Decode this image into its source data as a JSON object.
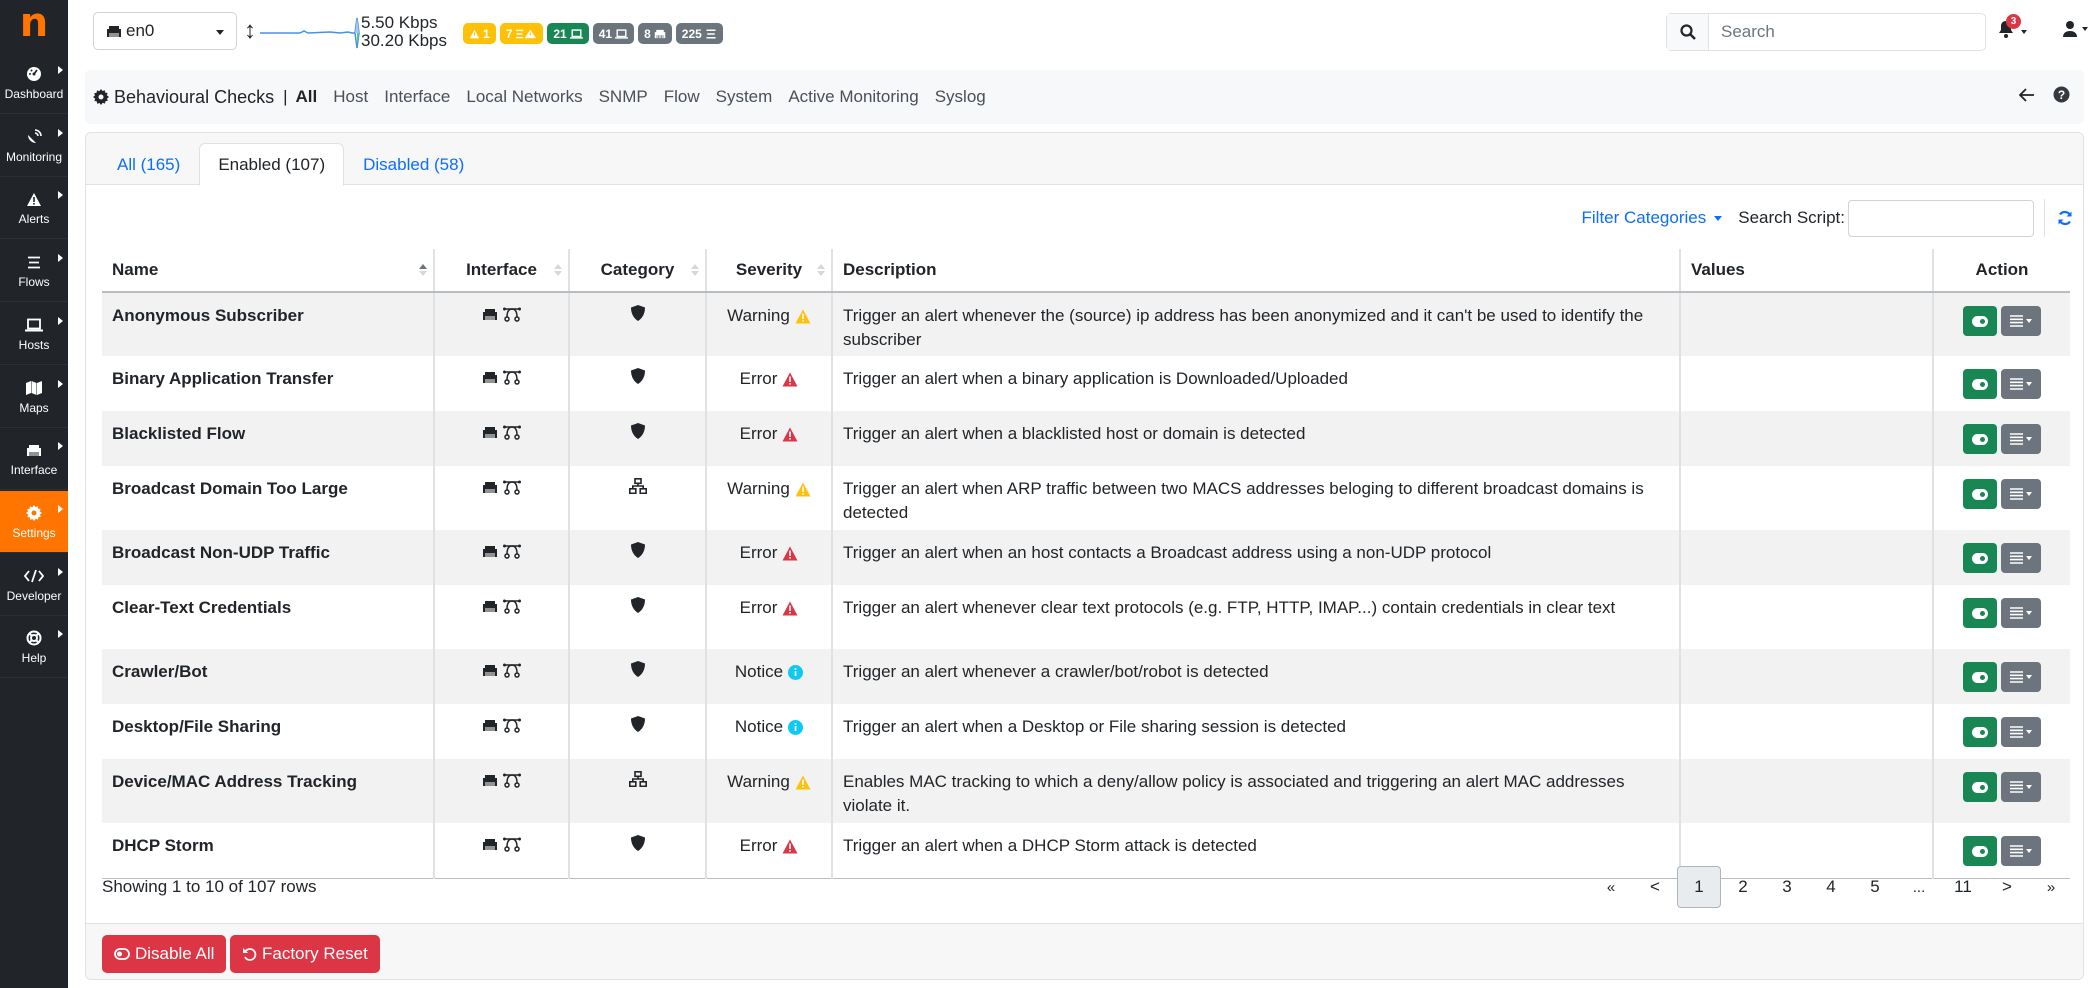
{
  "logo": "n",
  "sidebar": {
    "items": [
      {
        "label": "Dashboard",
        "icon": "gauge-icon"
      },
      {
        "label": "Monitoring",
        "icon": "satellite-dish-icon"
      },
      {
        "label": "Alerts",
        "icon": "warning-icon"
      },
      {
        "label": "Flows",
        "icon": "list-icon"
      },
      {
        "label": "Hosts",
        "icon": "laptop-icon"
      },
      {
        "label": "Maps",
        "icon": "map-icon"
      },
      {
        "label": "Interface",
        "icon": "ethernet-icon"
      },
      {
        "label": "Settings",
        "icon": "gear-icon",
        "active": true
      },
      {
        "label": "Developer",
        "icon": "code-icon"
      },
      {
        "label": "Help",
        "icon": "life-ring-icon"
      }
    ]
  },
  "topbar": {
    "interface": "en0",
    "upload_speed": "5.50 Kbps",
    "download_speed": "30.20 Kbps",
    "badges": [
      {
        "value": "1",
        "icon": "warning-icon",
        "color": "#ffc107"
      },
      {
        "value": "7",
        "icon": "flow-warning-icon",
        "color": "#ffc107"
      },
      {
        "value": "21",
        "icon": "laptop-icon",
        "color": "#198754"
      },
      {
        "value": "41",
        "icon": "laptop-icon",
        "color": "#6c757d"
      },
      {
        "value": "8",
        "icon": "ethernet-icon",
        "color": "#6c757d"
      },
      {
        "value": "225",
        "icon": "list-icon",
        "color": "#6c757d"
      }
    ],
    "search_placeholder": "Search",
    "notifications_count": "3"
  },
  "breadcrumb": {
    "title": "Behavioural Checks",
    "separator": "|",
    "links": [
      {
        "label": "All",
        "active": true
      },
      {
        "label": "Host"
      },
      {
        "label": "Interface"
      },
      {
        "label": "Local Networks"
      },
      {
        "label": "SNMP"
      },
      {
        "label": "Flow"
      },
      {
        "label": "System"
      },
      {
        "label": "Active Monitoring"
      },
      {
        "label": "Syslog"
      }
    ]
  },
  "tabs": [
    {
      "label": "All (165)"
    },
    {
      "label": "Enabled (107)",
      "active": true
    },
    {
      "label": "Disabled (58)"
    }
  ],
  "toolbar": {
    "filter_label": "Filter Categories",
    "search_label": "Search Script:",
    "search_value": ""
  },
  "table": {
    "columns": [
      "Name",
      "Interface",
      "Category",
      "Severity",
      "Description",
      "Values",
      "Action"
    ],
    "rows": [
      {
        "name": "Anonymous Subscriber",
        "category": "security",
        "severity": "Warning",
        "description": "Trigger an alert whenever the (source) ip address has been anonymized and it can't be used to identify the subscriber",
        "values": ""
      },
      {
        "name": "Binary Application Transfer",
        "category": "security",
        "severity": "Error",
        "description": "Trigger an alert when a binary application is Downloaded/Uploaded",
        "values": ""
      },
      {
        "name": "Blacklisted Flow",
        "category": "security",
        "severity": "Error",
        "description": "Trigger an alert when a blacklisted host or domain is detected",
        "values": ""
      },
      {
        "name": "Broadcast Domain Too Large",
        "category": "network",
        "severity": "Warning",
        "description": "Trigger an alert when ARP traffic between two MACS addresses beloging to different broadcast domains is detected",
        "values": ""
      },
      {
        "name": "Broadcast Non-UDP Traffic",
        "category": "security",
        "severity": "Error",
        "description": "Trigger an alert when an host contacts a Broadcast address using a non-UDP protocol",
        "values": ""
      },
      {
        "name": "Clear-Text Credentials",
        "category": "security",
        "severity": "Error",
        "description": "Trigger an alert whenever clear text protocols (e.g. FTP, HTTP, IMAP...) contain credentials in clear text",
        "values": ""
      },
      {
        "name": "Crawler/Bot",
        "category": "security",
        "severity": "Notice",
        "description": "Trigger an alert whenever a crawler/bot/robot is detected",
        "values": ""
      },
      {
        "name": "Desktop/File Sharing",
        "category": "security",
        "severity": "Notice",
        "description": "Trigger an alert when a Desktop or File sharing session is detected",
        "values": ""
      },
      {
        "name": "Device/MAC Address Tracking",
        "category": "network",
        "severity": "Warning",
        "description": "Enables MAC tracking to which a deny/allow policy is associated and triggering an alert MAC addresses violate it.",
        "values": ""
      },
      {
        "name": "DHCP Storm",
        "category": "security",
        "severity": "Error",
        "description": "Trigger an alert when a DHCP Storm attack is detected",
        "values": ""
      }
    ]
  },
  "severity_colors": {
    "Warning": "#ffc107",
    "Error": "#dc3545",
    "Notice": "#0dcaf0"
  },
  "pagination": {
    "summary": "Showing 1 to 10 of 107 rows",
    "first": "«",
    "prev": "<",
    "pages": [
      "1",
      "2",
      "3",
      "4",
      "5",
      "...",
      "11"
    ],
    "current": "1",
    "next": ">",
    "last": "»"
  },
  "footer": {
    "disable_all": "Disable All",
    "factory_reset": "Factory Reset"
  }
}
